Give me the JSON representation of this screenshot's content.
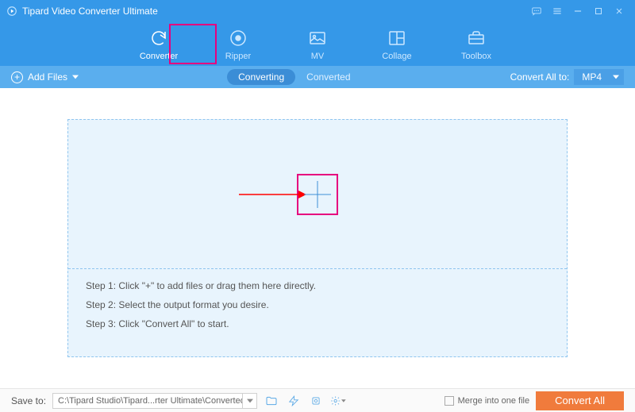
{
  "titlebar": {
    "title": "Tipard Video Converter Ultimate"
  },
  "nav": {
    "items": [
      {
        "label": "Converter"
      },
      {
        "label": "Ripper"
      },
      {
        "label": "MV"
      },
      {
        "label": "Collage"
      },
      {
        "label": "Toolbox"
      }
    ]
  },
  "toolbar": {
    "add_files": "Add Files",
    "tab_converting": "Converting",
    "tab_converted": "Converted",
    "convert_all_label": "Convert All to:",
    "format": "MP4"
  },
  "dropzone": {
    "step1": "Step 1: Click \"+\" to add files or drag them here directly.",
    "step2": "Step 2: Select the output format you desire.",
    "step3": "Step 3: Click \"Convert All\" to start."
  },
  "footer": {
    "save_to": "Save to:",
    "path": "C:\\Tipard Studio\\Tipard...rter Ultimate\\Converted",
    "merge": "Merge into one file",
    "convert_all": "Convert All"
  }
}
